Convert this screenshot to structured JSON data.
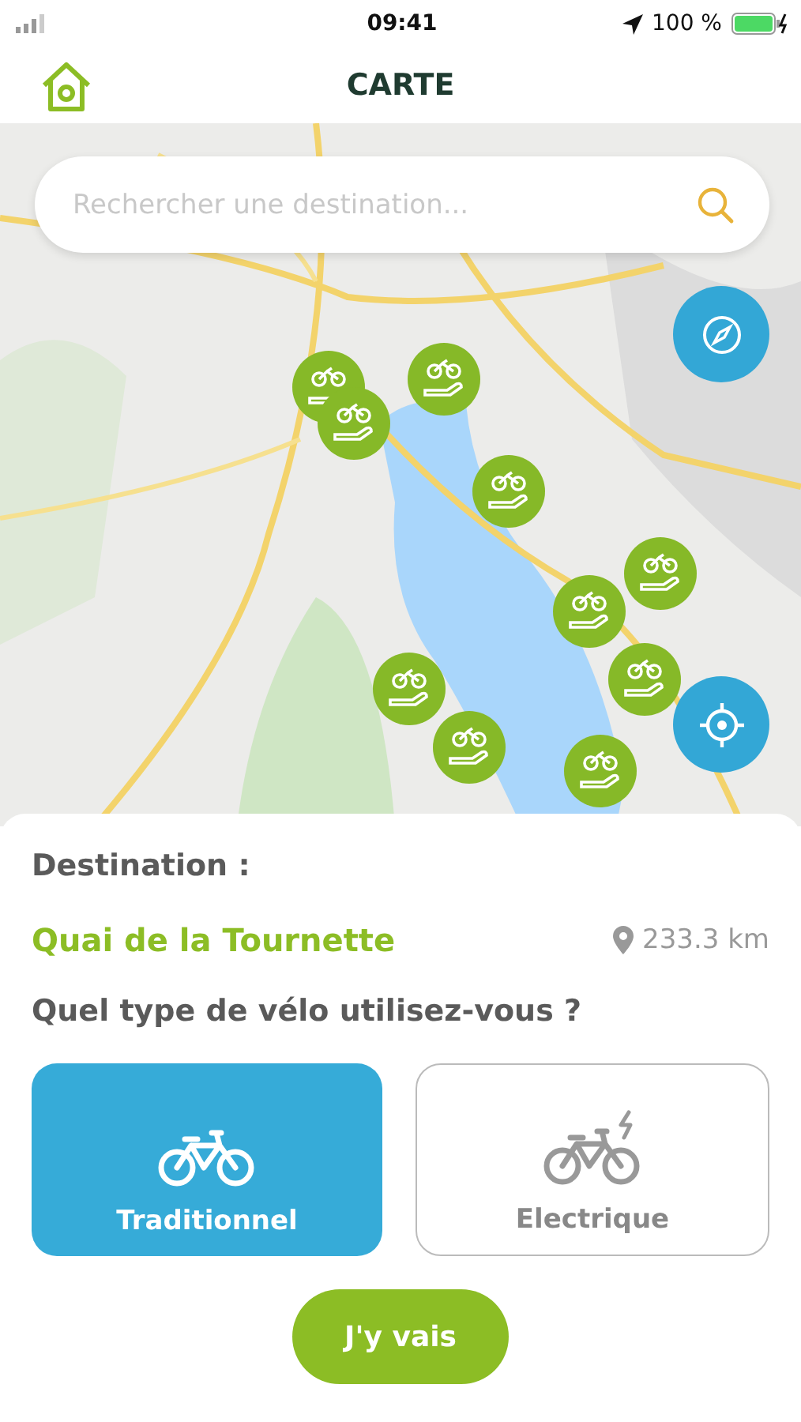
{
  "status_bar": {
    "time": "09:41",
    "battery": "100 %"
  },
  "header": {
    "title": "CARTE"
  },
  "search": {
    "placeholder": "Rechercher une destination..."
  },
  "sheet": {
    "label": "Destination :",
    "destination": "Quai de la Tournette",
    "distance": "233.3 km",
    "question": "Quel type de vélo utilisez-vous ?",
    "options": [
      {
        "kind": "traditional",
        "label": "Traditionnel",
        "selected": true
      },
      {
        "kind": "electric",
        "label": "Electrique",
        "selected": false
      }
    ],
    "button": "J'y vais"
  }
}
